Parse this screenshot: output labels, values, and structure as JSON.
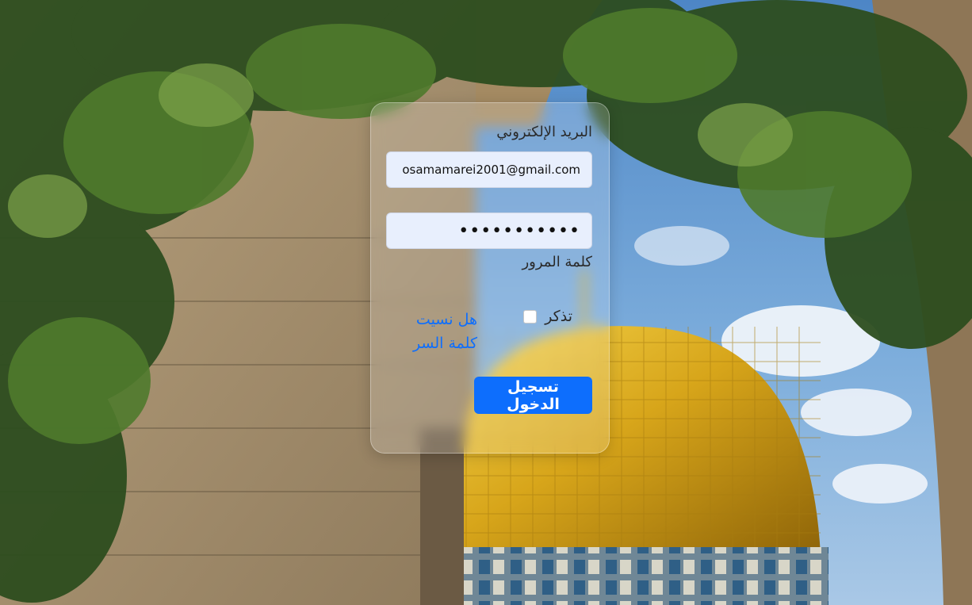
{
  "login": {
    "email_label": "البريد الإلكتروني",
    "email_value": "osamamarei2001@gmail.com",
    "password_label": "كلمة المرور",
    "password_value": "•••••••••••",
    "remember_label": "تذكر",
    "forgot_password_link": "هل نسيت كلمة السر",
    "submit_label": "تسجيل الدخول"
  },
  "colors": {
    "primary_button": "#0d6efd",
    "link": "#0d6efd",
    "input_background": "#e8effd"
  },
  "background": {
    "scene": "dome-of-the-rock-through-stone-arch-with-trees"
  }
}
